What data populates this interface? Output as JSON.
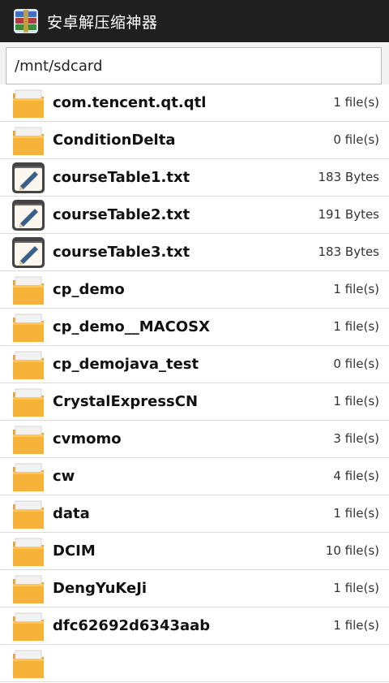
{
  "app": {
    "title": "安卓解压缩神器",
    "icon": "winrar-books-icon"
  },
  "path": {
    "value": "/mnt/sdcard"
  },
  "files": [
    {
      "name": "com.tencent.qt.qtl",
      "meta": "1 file(s)",
      "type": "folder"
    },
    {
      "name": "ConditionDelta",
      "meta": "0 file(s)",
      "type": "folder"
    },
    {
      "name": "courseTable1.txt",
      "meta": "183 Bytes",
      "type": "text"
    },
    {
      "name": "courseTable2.txt",
      "meta": "191 Bytes",
      "type": "text"
    },
    {
      "name": "courseTable3.txt",
      "meta": "183 Bytes",
      "type": "text"
    },
    {
      "name": "cp_demo",
      "meta": "1 file(s)",
      "type": "folder"
    },
    {
      "name": "cp_demo__MACOSX",
      "meta": "1 file(s)",
      "type": "folder"
    },
    {
      "name": "cp_demojava_test",
      "meta": "0 file(s)",
      "type": "folder"
    },
    {
      "name": "CrystalExpressCN",
      "meta": "1 file(s)",
      "type": "folder"
    },
    {
      "name": "cvmomo",
      "meta": "3 file(s)",
      "type": "folder"
    },
    {
      "name": "cw",
      "meta": "4 file(s)",
      "type": "folder"
    },
    {
      "name": "data",
      "meta": "1 file(s)",
      "type": "folder"
    },
    {
      "name": "DCIM",
      "meta": "10 file(s)",
      "type": "folder"
    },
    {
      "name": "DengYuKeJi",
      "meta": "1 file(s)",
      "type": "folder"
    },
    {
      "name": "dfc62692d6343aab",
      "meta": "1 file(s)",
      "type": "folder"
    },
    {
      "name": "",
      "meta": "",
      "type": "folder"
    }
  ],
  "colors": {
    "titlebar": "#1f1f1f",
    "folder": "#f7b23a",
    "folder_tab": "#f2f2f2",
    "text_icon": "#444444"
  }
}
